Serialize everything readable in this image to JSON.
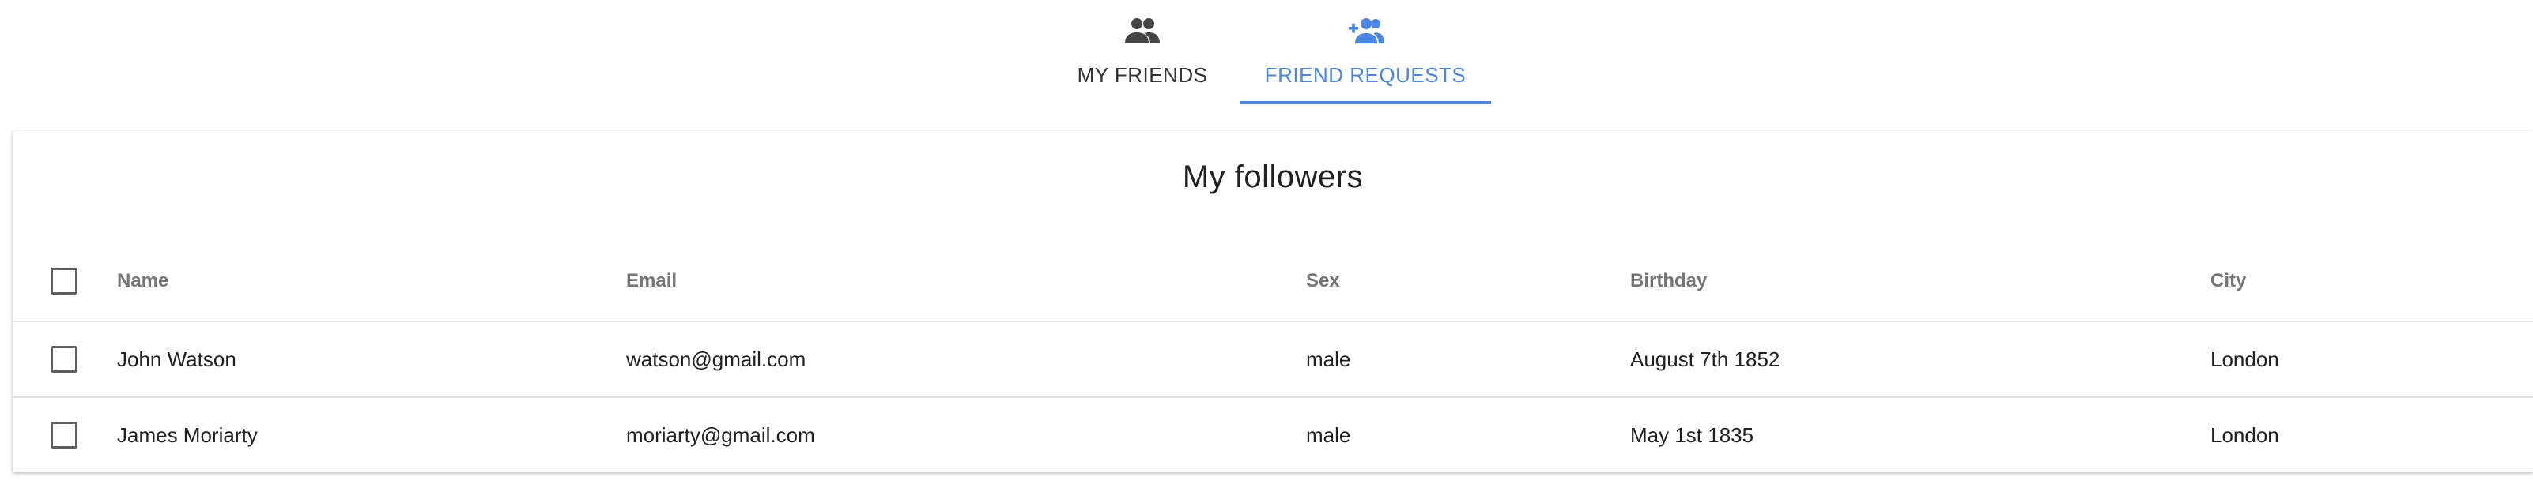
{
  "tabs": [
    {
      "label": "MY FRIENDS",
      "icon": "people-icon",
      "active": false
    },
    {
      "label": "FRIEND REQUESTS",
      "icon": "person-add-icon",
      "active": true
    }
  ],
  "colors": {
    "accent": "#4a86e8",
    "inactive_tab": "#333333",
    "header_text": "#757575"
  },
  "card": {
    "title": "My followers",
    "columns": {
      "name": "Name",
      "email": "Email",
      "sex": "Sex",
      "birthday": "Birthday",
      "city": "City"
    },
    "rows": [
      {
        "name": "John Watson",
        "email": "watson@gmail.com",
        "sex": "male",
        "birthday": "August 7th 1852",
        "city": "London"
      },
      {
        "name": "James Moriarty",
        "email": "moriarty@gmail.com",
        "sex": "male",
        "birthday": "May 1st 1835",
        "city": "London"
      }
    ]
  }
}
